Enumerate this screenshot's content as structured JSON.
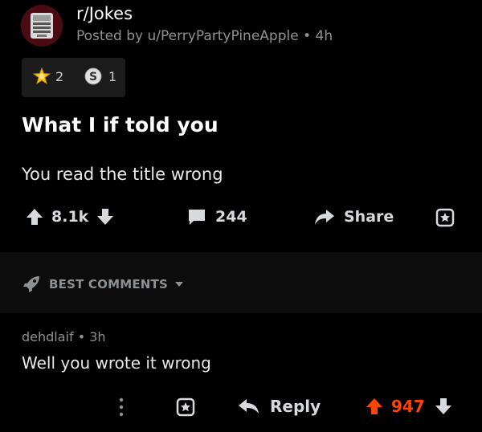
{
  "post": {
    "subreddit": "r/Jokes",
    "posted_by": "Posted by u/PerryPartyPineApple",
    "age": "4h",
    "awards": [
      {
        "icon": "gold-award-icon",
        "count": "2"
      },
      {
        "icon": "silver-award-icon",
        "count": "1"
      }
    ],
    "title": "What I if told you",
    "body": "You read the title wrong",
    "upvotes": "8.1k",
    "comments": "244",
    "share_label": "Share"
  },
  "sort": {
    "label": "BEST COMMENTS"
  },
  "comment": {
    "author": "dehdlaif",
    "age": "3h",
    "body": "Well you wrote it wrong",
    "reply_label": "Reply",
    "score": "947"
  },
  "colors": {
    "background": "#000000",
    "upvoted": "#ff4500",
    "muted": "#8e9194",
    "text": "#d7dadc"
  }
}
